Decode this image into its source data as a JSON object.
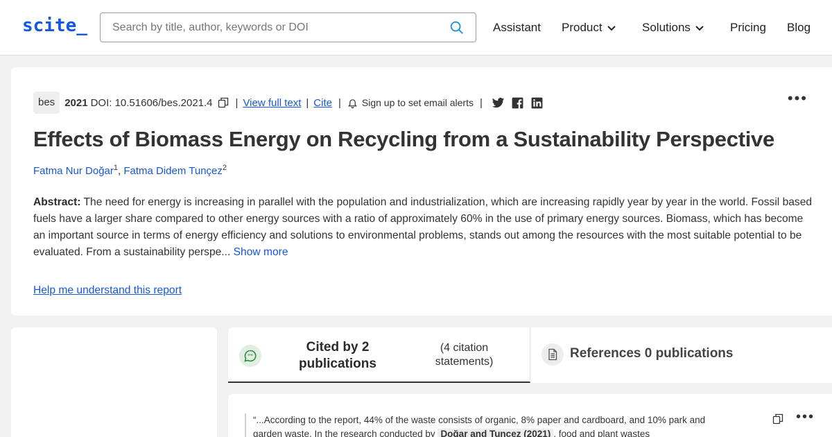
{
  "header": {
    "logo": "scite_",
    "search_placeholder": "Search by title, author, keywords or DOI",
    "nav": {
      "assistant": "Assistant",
      "product": "Product",
      "solutions": "Solutions",
      "pricing": "Pricing",
      "blog": "Blog"
    }
  },
  "paper": {
    "journal": "bes",
    "year": "2021",
    "doi": "DOI: 10.51606/bes.2021.4",
    "view_full_text": "View full text",
    "cite": "Cite",
    "alerts": "Sign up to set email alerts",
    "title": "Effects of Biomass Energy on Recycling from a Sustainability Perspective",
    "authors": [
      {
        "name": "Fatma Nur Doğar",
        "sup": "1"
      },
      {
        "name": "Fatma Didem Tunçez",
        "sup": "2"
      }
    ],
    "abstract_label": "Abstract:",
    "abstract_text": "The need for energy is increasing in parallel with the population and industrialization, which are increasing rapidly year by year in the world. Fossil based fuels have a larger share compared to other energy sources with a ratio of approximately 60% in the use of primary energy sources. Biomass, which has become an important source in terms of energy efficiency and solutions to environmental problems, stands out among the resources with the most suitable potential to be evaluated. From a sustainability perspe...",
    "show_more": "Show more",
    "help_link": "Help me understand this report"
  },
  "tabs": {
    "cited_by": "Cited by 2 publications",
    "citation_statements": "(4 citation statements)",
    "references": "References 0 publications"
  },
  "citation": {
    "quote_before": "“...According to the report, 44% of the waste consists of organic, 8% paper and cardboard, and 10% park and garden waste. In the research conducted by",
    "highlight": "Doğar and Tunçez (2021)",
    "quote_after": ", food and plant wastes"
  },
  "colors": {
    "brand": "#1458e0",
    "cited_icon": "#2e8b3e"
  },
  "icons": [
    "search-icon",
    "chevron-down-icon",
    "copy-icon",
    "bell-icon",
    "twitter-icon",
    "facebook-icon",
    "linkedin-icon",
    "more-icon",
    "quote-bubble-icon",
    "document-icon"
  ]
}
